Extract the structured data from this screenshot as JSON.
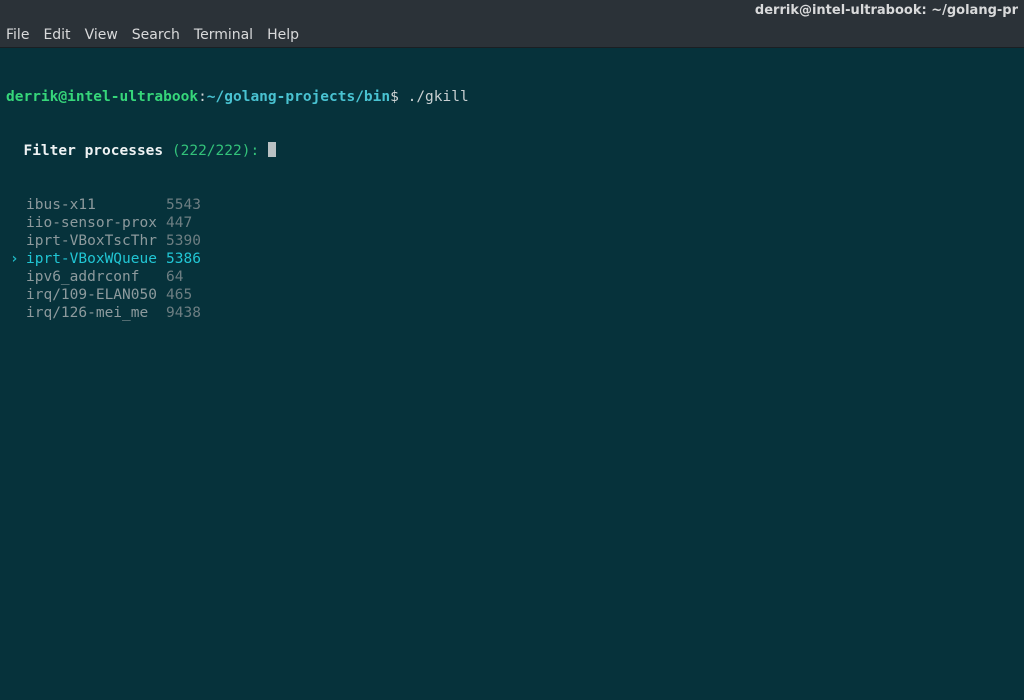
{
  "titlebar": {
    "text": "derrik@intel-ultrabook: ~/golang-pr"
  },
  "menubar": {
    "items": [
      "File",
      "Edit",
      "View",
      "Search",
      "Terminal",
      "Help"
    ]
  },
  "prompt": {
    "user_host": "derrik@intel-ultrabook",
    "separator": ":",
    "path": "~/golang-projects/bin",
    "suffix": "$",
    "command": "./gkill"
  },
  "filter": {
    "label": "Filter processes",
    "count": "(222/222):"
  },
  "processes": {
    "selected_index": 3,
    "rows": [
      {
        "name": "ibus-x11",
        "pid": "5543"
      },
      {
        "name": "iio-sensor-prox",
        "pid": "447"
      },
      {
        "name": "iprt-VBoxTscThr",
        "pid": "5390"
      },
      {
        "name": "iprt-VBoxWQueue",
        "pid": "5386"
      },
      {
        "name": "ipv6_addrconf",
        "pid": "64"
      },
      {
        "name": "irq/109-ELAN050",
        "pid": "465"
      },
      {
        "name": "irq/126-mei_me",
        "pid": "9438"
      }
    ]
  },
  "glyphs": {
    "selection_marker": "›"
  }
}
